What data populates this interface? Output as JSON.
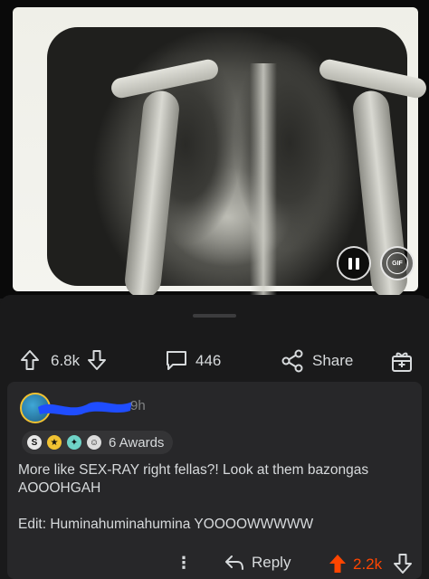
{
  "post": {
    "media_type": "GIF",
    "gif_badge": "GIF"
  },
  "action_bar": {
    "vote_count": "6.8k",
    "comment_count": "446",
    "share_label": "Share"
  },
  "comment": {
    "time": "9h",
    "awards_label": "6 Awards",
    "body": "More like SEX-RAY right fellas?! Look at them bazongas\nAOOOHGAH",
    "edit": "Edit: Huminahuminahumina YOOOOWWWWW",
    "reply_label": "Reply",
    "score": "2.2k",
    "score_color": "#ff4500"
  },
  "icons": [
    "pause-icon",
    "gif-icon",
    "upvote-icon",
    "downvote-icon",
    "comment-icon",
    "share-icon",
    "award-icon",
    "more-icon",
    "reply-icon"
  ]
}
